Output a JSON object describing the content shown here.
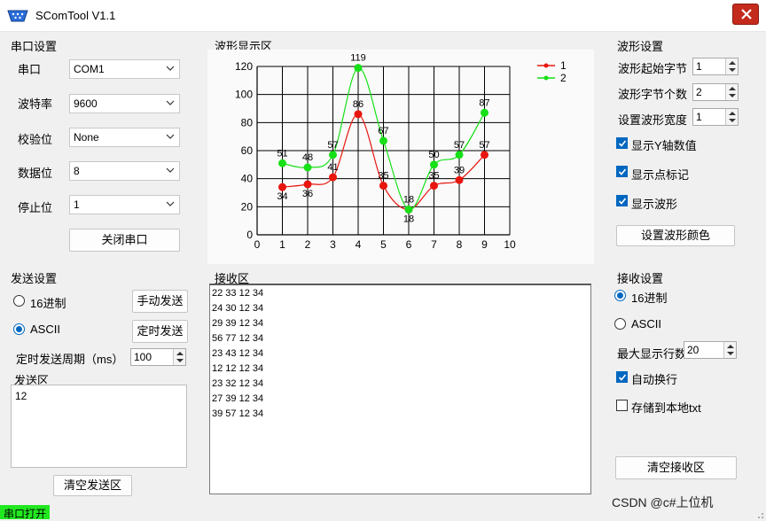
{
  "window": {
    "title": "SComTool V1.1"
  },
  "serial": {
    "group_title": "串口设置",
    "port": {
      "label": "串口",
      "value": "COM1"
    },
    "baud": {
      "label": "波特率",
      "value": "9600"
    },
    "parity": {
      "label": "校验位",
      "value": "None"
    },
    "databits": {
      "label": "数据位",
      "value": "8"
    },
    "stopbits": {
      "label": "停止位",
      "value": "1"
    },
    "toggle_button": "关闭串口"
  },
  "wave": {
    "group_title": "波形显示区"
  },
  "wave_settings": {
    "group_title": "波形设置",
    "start_byte": {
      "label": "波形起始字节",
      "value": "1"
    },
    "byte_count": {
      "label": "波形字节个数",
      "value": "2"
    },
    "width": {
      "label": "设置波形宽度",
      "value": "1"
    },
    "show_y": {
      "label": "显示Y轴数值",
      "checked": true
    },
    "show_points": {
      "label": "显示点标记",
      "checked": true
    },
    "show_wave": {
      "label": "显示波形",
      "checked": true
    },
    "color_button": "设置波形颜色"
  },
  "send": {
    "group_title": "发送设置",
    "hex_label": "16进制",
    "ascii_label": "ASCII",
    "selected": "ASCII",
    "manual_button": "手动发送",
    "timed_button": "定时发送",
    "period_label": "定时发送周期（ms）",
    "period_value": "100",
    "area_label": "发送区",
    "area_text": "12",
    "clear_button": "清空发送区"
  },
  "receive": {
    "group_title": "接收区",
    "lines": [
      "22 33 12 34",
      "24 30 12 34",
      "29 39 12 34",
      "56 77 12 34",
      "23 43 12 34",
      "12 12 12 34",
      "23 32 12 34",
      "27 39 12 34",
      "39 57 12 34"
    ]
  },
  "recv_settings": {
    "group_title": "接收设置",
    "hex_label": "16进制",
    "ascii_label": "ASCII",
    "selected": "16进制",
    "max_lines_label": "最大显示行数",
    "max_lines_value": "20",
    "auto_wrap": {
      "label": "自动换行",
      "checked": true
    },
    "save_local": {
      "label": "存储到本地txt",
      "checked": false
    },
    "clear_button": "清空接收区"
  },
  "status": {
    "text": "串口打开"
  },
  "watermark": "CSDN @c#上位机",
  "colors": {
    "series1": "#e8160e",
    "series2": "#16e016",
    "status_ok": "#21e81f",
    "accent": "#0067c0"
  },
  "chart_data": {
    "type": "line",
    "title": "",
    "xlabel": "",
    "ylabel": "",
    "xlim": [
      0,
      10
    ],
    "ylim": [
      0,
      120
    ],
    "x_ticks": [
      "0",
      "1",
      "2",
      "3",
      "4",
      "5",
      "6",
      "7",
      "8",
      "9",
      "10"
    ],
    "y_ticks": [
      "0",
      "20",
      "40",
      "60",
      "80",
      "100",
      "120"
    ],
    "grid": true,
    "legend_position": "top-right",
    "x": [
      1,
      2,
      3,
      4,
      5,
      6,
      7,
      8,
      9
    ],
    "series": [
      {
        "name": "1",
        "color": "#e8160e",
        "values": [
          34,
          36,
          41,
          86,
          35,
          18,
          35,
          39,
          57
        ]
      },
      {
        "name": "2",
        "color": "#16e016",
        "values": [
          51,
          48,
          57,
          119,
          67,
          18,
          50,
          57,
          87
        ]
      }
    ]
  }
}
